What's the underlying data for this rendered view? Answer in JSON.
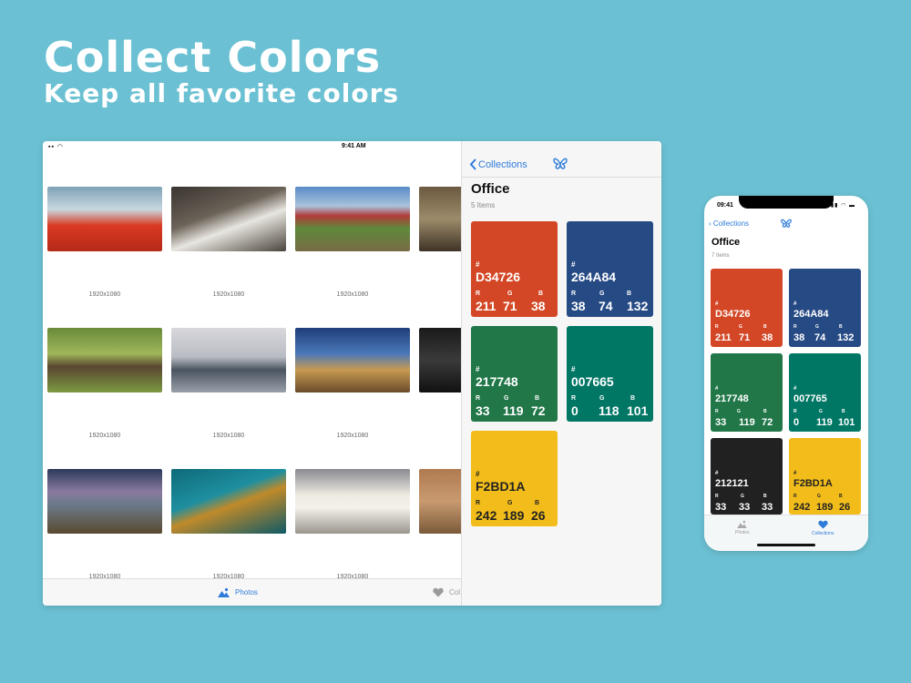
{
  "hero": {
    "title": "Collect Colors",
    "subtitle": "Keep all favorite colors"
  },
  "ipad": {
    "status": {
      "time": "9:41 AM"
    },
    "thumb_label": "1920x1080",
    "tabs": {
      "photos": "Photos",
      "collections": "Col"
    },
    "panel": {
      "back": "Collections",
      "title": "Office",
      "count": "5 Items"
    },
    "swatches": [
      {
        "hex": "D34726",
        "r": "211",
        "g": "71",
        "b": "38",
        "color": "#d34726"
      },
      {
        "hex": "264A84",
        "r": "38",
        "g": "74",
        "b": "132",
        "color": "#264a84"
      },
      {
        "hex": "217748",
        "r": "33",
        "g": "119",
        "b": "72",
        "color": "#217748"
      },
      {
        "hex": "007665",
        "r": "0",
        "g": "118",
        "b": "101",
        "color": "#007665"
      },
      {
        "hex": "F2BD1A",
        "r": "242",
        "g": "189",
        "b": "26",
        "color": "#f2bd1a"
      }
    ]
  },
  "iphone": {
    "time": "09:41",
    "back": "Collections",
    "title": "Office",
    "count": "7 Items",
    "tabs": {
      "photos": "Photos",
      "collections": "Collections"
    },
    "swatches": [
      {
        "hex": "D34726",
        "r": "211",
        "g": "71",
        "b": "38",
        "color": "#d34726"
      },
      {
        "hex": "264A84",
        "r": "38",
        "g": "74",
        "b": "132",
        "color": "#264a84"
      },
      {
        "hex": "217748",
        "r": "33",
        "g": "119",
        "b": "72",
        "color": "#217748"
      },
      {
        "hex": "007765",
        "r": "0",
        "g": "119",
        "b": "101",
        "color": "#007765"
      },
      {
        "hex": "212121",
        "r": "33",
        "g": "33",
        "b": "33",
        "color": "#212121"
      },
      {
        "hex": "F2BD1A",
        "r": "242",
        "g": "189",
        "b": "26",
        "color": "#f2bd1a"
      }
    ]
  },
  "labels": {
    "hash": "#",
    "r": "R",
    "g": "G",
    "b": "B"
  },
  "colors": {
    "background": "#6bc1d3",
    "accent": "#2f7bd9"
  }
}
